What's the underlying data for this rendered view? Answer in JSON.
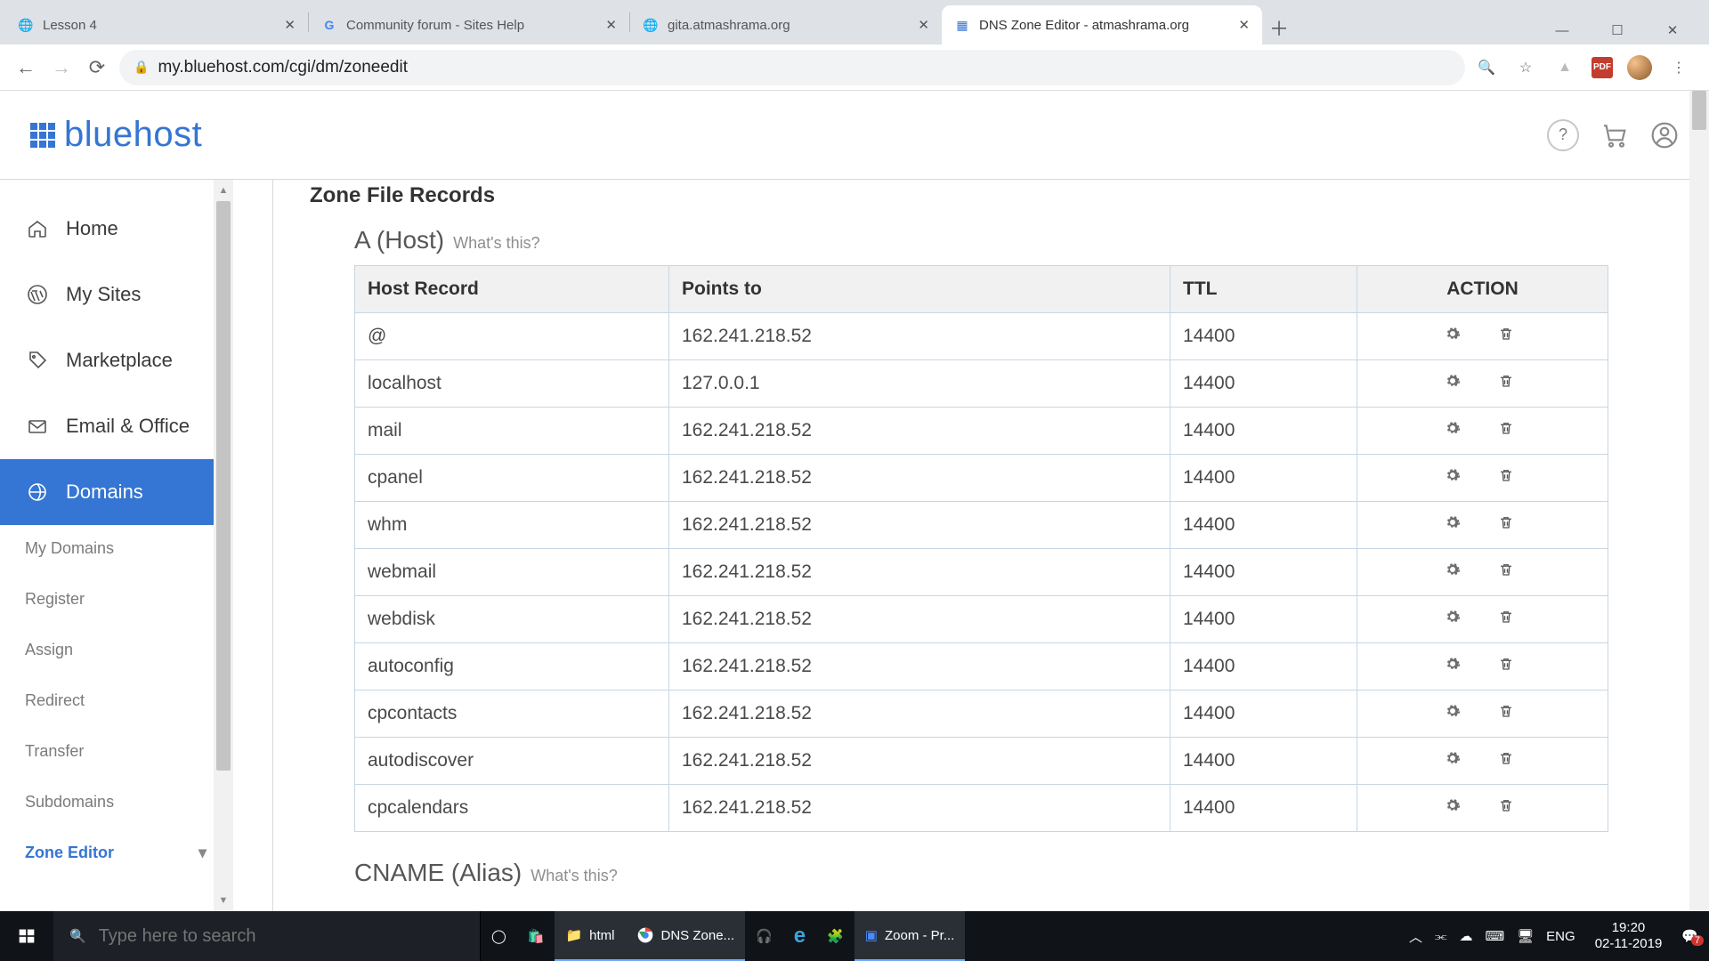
{
  "browser": {
    "tabs": [
      {
        "title": "Lesson 4",
        "favicon": "🌐"
      },
      {
        "title": "Community forum - Sites Help",
        "favicon": "G"
      },
      {
        "title": "gita.atmashrama.org",
        "favicon": "🌐"
      },
      {
        "title": "DNS Zone Editor - atmashrama.org",
        "favicon": "⊞"
      }
    ],
    "url": "my.bluehost.com/cgi/dm/zoneedit"
  },
  "header": {
    "brand": "bluehost"
  },
  "sidebar": {
    "items": [
      {
        "label": "Home",
        "icon": "home"
      },
      {
        "label": "My Sites",
        "icon": "wp"
      },
      {
        "label": "Marketplace",
        "icon": "tag"
      },
      {
        "label": "Email & Office",
        "icon": "mail"
      },
      {
        "label": "Domains",
        "icon": "domain"
      }
    ],
    "sub": [
      "My Domains",
      "Register",
      "Assign",
      "Redirect",
      "Transfer",
      "Subdomains",
      "Zone Editor"
    ]
  },
  "main": {
    "section": "Zone File Records",
    "table_title": "A (Host)",
    "whats": "What's this?",
    "cname_title": "CNAME (Alias)",
    "columns": [
      "Host Record",
      "Points to",
      "TTL",
      "ACTION"
    ],
    "rows": [
      {
        "host": "@",
        "points": "162.241.218.52",
        "ttl": "14400"
      },
      {
        "host": "localhost",
        "points": "127.0.0.1",
        "ttl": "14400"
      },
      {
        "host": "mail",
        "points": "162.241.218.52",
        "ttl": "14400"
      },
      {
        "host": "cpanel",
        "points": "162.241.218.52",
        "ttl": "14400"
      },
      {
        "host": "whm",
        "points": "162.241.218.52",
        "ttl": "14400"
      },
      {
        "host": "webmail",
        "points": "162.241.218.52",
        "ttl": "14400"
      },
      {
        "host": "webdisk",
        "points": "162.241.218.52",
        "ttl": "14400"
      },
      {
        "host": "autoconfig",
        "points": "162.241.218.52",
        "ttl": "14400"
      },
      {
        "host": "cpcontacts",
        "points": "162.241.218.52",
        "ttl": "14400"
      },
      {
        "host": "autodiscover",
        "points": "162.241.218.52",
        "ttl": "14400"
      },
      {
        "host": "cpcalendars",
        "points": "162.241.218.52",
        "ttl": "14400"
      }
    ]
  },
  "taskbar": {
    "search_placeholder": "Type here to search",
    "items": [
      {
        "label": "html",
        "icon": "📁"
      },
      {
        "label": "DNS Zone...",
        "icon": "◉"
      },
      {
        "label": "",
        "icon": "🎧"
      },
      {
        "label": "",
        "icon": "e"
      },
      {
        "label": "",
        "icon": "🧩"
      },
      {
        "label": "Zoom - Pr...",
        "icon": "▣"
      }
    ],
    "lang": "ENG",
    "time": "19:20",
    "date": "02-11-2019",
    "notif_count": "7"
  }
}
